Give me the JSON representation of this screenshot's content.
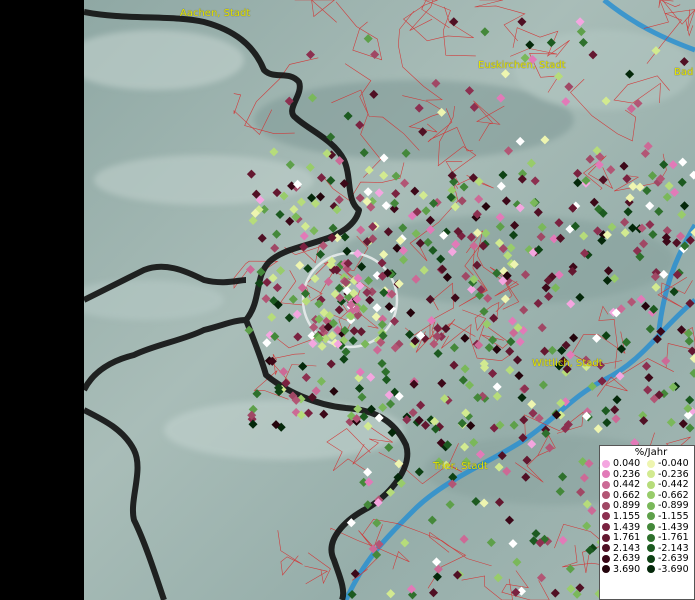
{
  "map": {
    "cities": [
      {
        "id": "aachen",
        "label": "Aachen, Stadt"
      },
      {
        "id": "euskirchen",
        "label": "Euskirchen, Stadt"
      },
      {
        "id": "bad",
        "label": "Bad"
      },
      {
        "id": "wittlich",
        "label": "Wittlich, Stadt"
      },
      {
        "id": "trier",
        "label": "Trier, Stadt"
      }
    ],
    "highlight": "circle-highlight"
  },
  "legend": {
    "title": "%/Jahr",
    "positive": [
      {
        "value": "0.040",
        "color": "#f4a6e0"
      },
      {
        "value": "0.236",
        "color": "#e27ab8"
      },
      {
        "value": "0.442",
        "color": "#cc6a96"
      },
      {
        "value": "0.662",
        "color": "#b25675"
      },
      {
        "value": "0.899",
        "color": "#a04865"
      },
      {
        "value": "1.155",
        "color": "#8c3050"
      },
      {
        "value": "1.439",
        "color": "#7a2240"
      },
      {
        "value": "1.761",
        "color": "#641830"
      },
      {
        "value": "2.143",
        "color": "#501024"
      },
      {
        "value": "2.639",
        "color": "#3c0818"
      },
      {
        "value": "3.690",
        "color": "#24040c"
      }
    ],
    "negative": [
      {
        "value": "-0.040",
        "color": "#eef5b0"
      },
      {
        "value": "-0.236",
        "color": "#d2ea90"
      },
      {
        "value": "-0.442",
        "color": "#b6dc7a"
      },
      {
        "value": "-0.662",
        "color": "#98cc6a"
      },
      {
        "value": "-0.899",
        "color": "#7ab85a"
      },
      {
        "value": "-1.155",
        "color": "#5ea04a"
      },
      {
        "value": "-1.439",
        "color": "#44883a"
      },
      {
        "value": "-1.761",
        "color": "#2e702c"
      },
      {
        "value": "-2.143",
        "color": "#1c5a20"
      },
      {
        "value": "-2.639",
        "color": "#0e4214"
      },
      {
        "value": "-3.690",
        "color": "#04280a"
      }
    ]
  }
}
